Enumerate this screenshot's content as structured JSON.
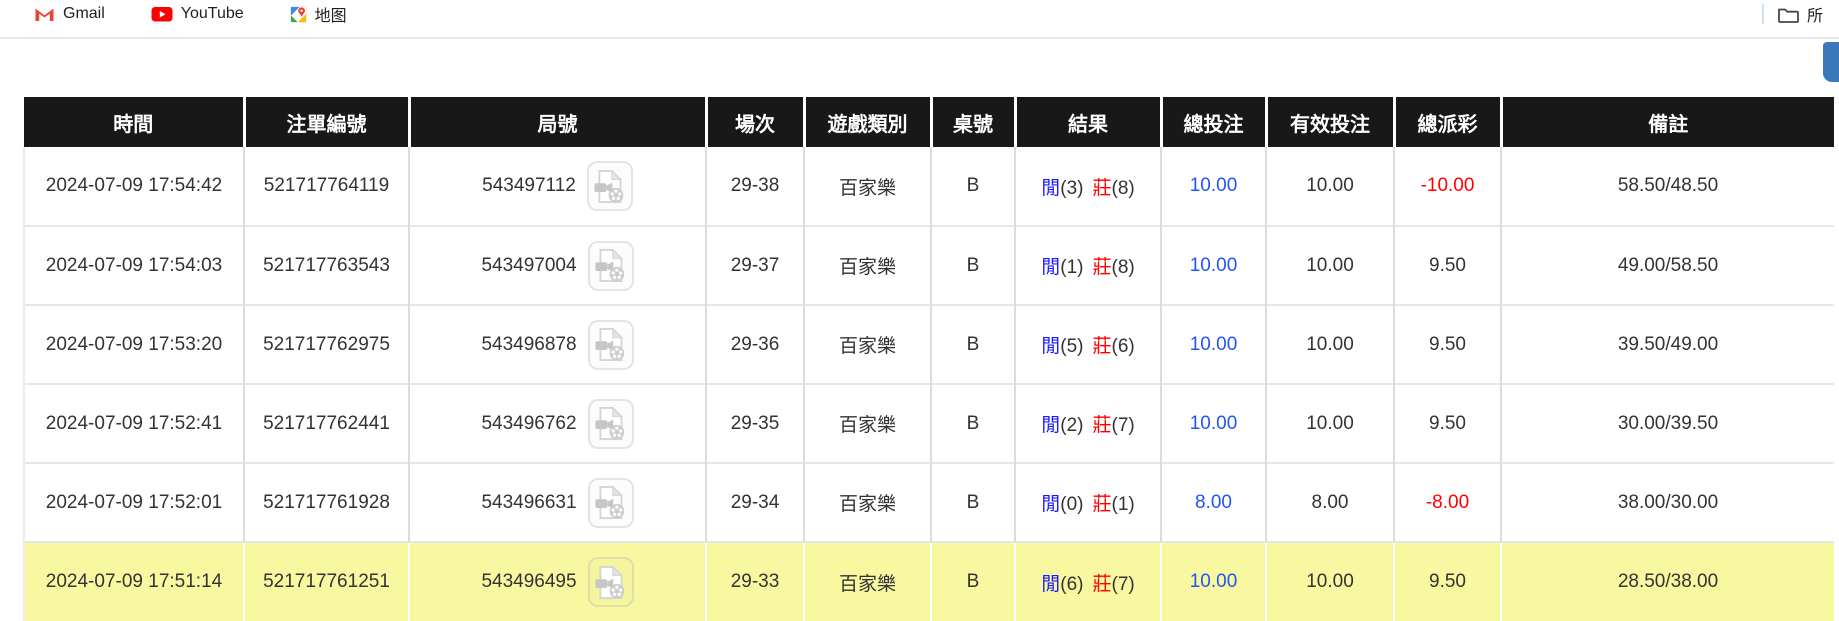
{
  "bookmarks_bar": {
    "items": [
      {
        "label": "Gmail"
      },
      {
        "label": "YouTube"
      },
      {
        "label": "地图"
      }
    ],
    "all_bookmarks_label": "所"
  },
  "table": {
    "columns": {
      "time": "時間",
      "bet_id": "注單編號",
      "round_id": "局號",
      "session": "場次",
      "game_type": "遊戲類別",
      "table_no": "桌號",
      "result": "結果",
      "total_bet": "總投注",
      "valid_bet": "有效投注",
      "total_payout": "總派彩",
      "remark": "備註"
    },
    "rows": [
      {
        "time": "2024-07-09 17:54:42",
        "bet_id": "521717764119",
        "round_id": "543497112",
        "session": "29-38",
        "game_type": "百家樂",
        "table_no": "B",
        "player": "閒",
        "player_points": "(3)",
        "banker": "莊",
        "banker_points": "(8)",
        "total_bet": "10.00",
        "valid_bet": "10.00",
        "payout": "-10.00",
        "payout_negative": true,
        "remark": "58.50/48.50",
        "highlighted": false
      },
      {
        "time": "2024-07-09 17:54:03",
        "bet_id": "521717763543",
        "round_id": "543497004",
        "session": "29-37",
        "game_type": "百家樂",
        "table_no": "B",
        "player": "閒",
        "player_points": "(1)",
        "banker": "莊",
        "banker_points": "(8)",
        "total_bet": "10.00",
        "valid_bet": "10.00",
        "payout": "9.50",
        "payout_negative": false,
        "remark": "49.00/58.50",
        "highlighted": false
      },
      {
        "time": "2024-07-09 17:53:20",
        "bet_id": "521717762975",
        "round_id": "543496878",
        "session": "29-36",
        "game_type": "百家樂",
        "table_no": "B",
        "player": "閒",
        "player_points": "(5)",
        "banker": "莊",
        "banker_points": "(6)",
        "total_bet": "10.00",
        "valid_bet": "10.00",
        "payout": "9.50",
        "payout_negative": false,
        "remark": "39.50/49.00",
        "highlighted": false
      },
      {
        "time": "2024-07-09 17:52:41",
        "bet_id": "521717762441",
        "round_id": "543496762",
        "session": "29-35",
        "game_type": "百家樂",
        "table_no": "B",
        "player": "閒",
        "player_points": "(2)",
        "banker": "莊",
        "banker_points": "(7)",
        "total_bet": "10.00",
        "valid_bet": "10.00",
        "payout": "9.50",
        "payout_negative": false,
        "remark": "30.00/39.50",
        "highlighted": false
      },
      {
        "time": "2024-07-09 17:52:01",
        "bet_id": "521717761928",
        "round_id": "543496631",
        "session": "29-34",
        "game_type": "百家樂",
        "table_no": "B",
        "player": "閒",
        "player_points": "(0)",
        "banker": "莊",
        "banker_points": "(1)",
        "total_bet": "8.00",
        "valid_bet": "8.00",
        "payout": "-8.00",
        "payout_negative": true,
        "remark": "38.00/30.00",
        "highlighted": false
      },
      {
        "time": "2024-07-09 17:51:14",
        "bet_id": "521717761251",
        "round_id": "543496495",
        "session": "29-33",
        "game_type": "百家樂",
        "table_no": "B",
        "player": "閒",
        "player_points": "(6)",
        "banker": "莊",
        "banker_points": "(7)",
        "total_bet": "10.00",
        "valid_bet": "10.00",
        "payout": "9.50",
        "payout_negative": false,
        "remark": "28.50/38.00",
        "highlighted": true
      }
    ]
  },
  "colors": {
    "header_bg": "#181818",
    "player_blue": "#1a1aff",
    "banker_red": "#ff0000",
    "bet_blue": "#2155f0",
    "negative_red": "#ff0000",
    "highlight_yellow": "#f8f8a1",
    "scrollbar_blue": "#3a78bb"
  }
}
